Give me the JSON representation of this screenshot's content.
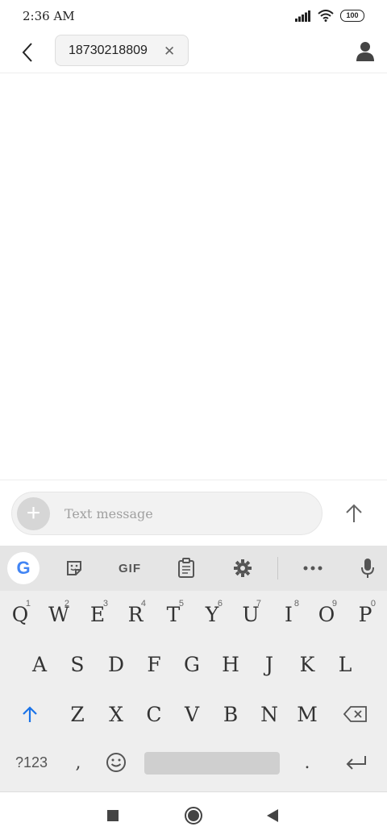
{
  "status": {
    "time": "2:36 AM",
    "battery": "100"
  },
  "header": {
    "recipient": "18730218809"
  },
  "compose": {
    "placeholder": "Text message"
  },
  "toolbar": {
    "gif": "GIF",
    "google": "G"
  },
  "keyboard": {
    "row1": [
      {
        "k": "Q",
        "n": "1"
      },
      {
        "k": "W",
        "n": "2"
      },
      {
        "k": "E",
        "n": "3"
      },
      {
        "k": "R",
        "n": "4"
      },
      {
        "k": "T",
        "n": "5"
      },
      {
        "k": "Y",
        "n": "6"
      },
      {
        "k": "U",
        "n": "7"
      },
      {
        "k": "I",
        "n": "8"
      },
      {
        "k": "O",
        "n": "9"
      },
      {
        "k": "P",
        "n": "0"
      }
    ],
    "row2": [
      "A",
      "S",
      "D",
      "F",
      "G",
      "H",
      "J",
      "K",
      "L"
    ],
    "row3": [
      "Z",
      "X",
      "C",
      "V",
      "B",
      "N",
      "M"
    ],
    "symbols": "?123",
    "comma": ",",
    "period": "."
  },
  "colors": {
    "accent": "#1a73e8"
  }
}
